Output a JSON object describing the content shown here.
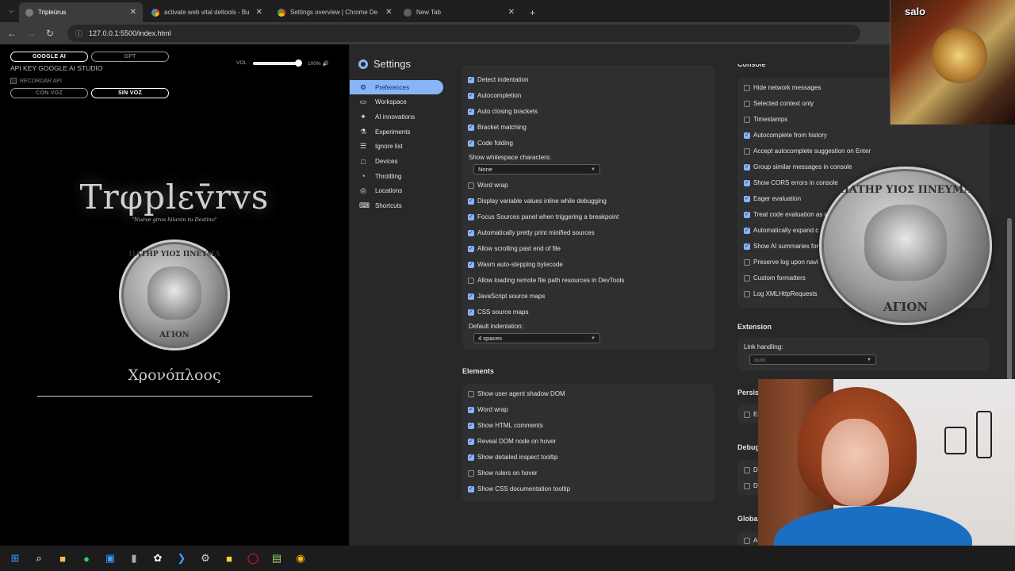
{
  "browser": {
    "tabs": [
      {
        "title": "Tripleūrus",
        "active": true
      },
      {
        "title": "activate web vital deltools - Bu"
      },
      {
        "title": "Settings overview | Chrome De"
      },
      {
        "title": "New Tab"
      }
    ],
    "url": "127.0.0.1:5500/index.html"
  },
  "app": {
    "btn_google": "GOOGLE AI",
    "btn_gpt": "GPT",
    "api_key_label": "API KEY GOOGLE AI STUDIO",
    "remember_label": "RECORDAR API",
    "btn_con_voz": "CON VOZ",
    "btn_sin_voz": "SIN VOZ",
    "vol_label": "VOL",
    "vol_pct": "100%",
    "volume": 0.95,
    "logo": "Trφplεv̄rvs",
    "tagline": "\"Nueve giros hilarán tu Destino\"",
    "coin_top": "ΠΑΤΗΡ ΥΙΟΣ ΠΝΕΥΜΑ",
    "coin_bottom": "ΑΓΙΟΝ",
    "subtitle": "Χρονόπλοος"
  },
  "settings": {
    "title": "Settings",
    "nav": [
      {
        "label": "Preferences",
        "icon": "gear-icon",
        "selected": true
      },
      {
        "label": "Workspace",
        "icon": "folder-icon"
      },
      {
        "label": "AI innovations",
        "icon": "sparkle-icon"
      },
      {
        "label": "Experiments",
        "icon": "flask-icon"
      },
      {
        "label": "Ignore list",
        "icon": "list-icon"
      },
      {
        "label": "Devices",
        "icon": "devices-icon"
      },
      {
        "label": "Throttling",
        "icon": "speedometer-icon"
      },
      {
        "label": "Locations",
        "icon": "pin-icon"
      },
      {
        "label": "Shortcuts",
        "icon": "keyboard-icon"
      }
    ],
    "sources": [
      {
        "label": "Detect indentation",
        "checked": true
      },
      {
        "label": "Autocompletion",
        "checked": true
      },
      {
        "label": "Auto closing brackets",
        "checked": true
      },
      {
        "label": "Bracket matching",
        "checked": true
      },
      {
        "label": "Code folding",
        "checked": true
      }
    ],
    "whitespace_label": "Show whitespace characters:",
    "whitespace_value": "None",
    "sources2": [
      {
        "label": "Word wrap",
        "checked": false
      },
      {
        "label": "Display variable values inline while debugging",
        "checked": true
      },
      {
        "label": "Focus Sources panel when triggering a breakpoint",
        "checked": true
      },
      {
        "label": "Automatically pretty print minified sources",
        "checked": true
      },
      {
        "label": "Allow scrolling past end of file",
        "checked": true
      },
      {
        "label": "Wasm auto-stepping bytecode",
        "checked": true
      },
      {
        "label": "Allow loading remote file path resources in DevTools",
        "checked": false
      },
      {
        "label": "JavaScript source maps",
        "checked": true
      },
      {
        "label": "CSS source maps",
        "checked": true
      }
    ],
    "indent_label": "Default indentation:",
    "indent_value": "4 spaces",
    "elements_title": "Elements",
    "elements": [
      {
        "label": "Show user agent shadow DOM",
        "checked": false
      },
      {
        "label": "Word wrap",
        "checked": true
      },
      {
        "label": "Show HTML comments",
        "checked": true
      },
      {
        "label": "Reveal DOM node on hover",
        "checked": true
      },
      {
        "label": "Show detailed inspect tooltip",
        "checked": true
      },
      {
        "label": "Show rulers on hover",
        "checked": false
      },
      {
        "label": "Show CSS documentation tooltip",
        "checked": true
      }
    ],
    "console_title": "Console",
    "console": [
      {
        "label": "Hide network messages",
        "checked": false
      },
      {
        "label": "Selected context only",
        "checked": false
      },
      {
        "label": "Timestamps",
        "checked": false
      },
      {
        "label": "Autocomplete from history",
        "checked": true
      },
      {
        "label": "Accept autocomplete suggestion on Enter",
        "checked": false
      },
      {
        "label": "Group similar messages in console",
        "checked": true
      },
      {
        "label": "Show CORS errors in console",
        "checked": true
      },
      {
        "label": "Eager evaluation",
        "checked": true
      },
      {
        "label": "Treat code evaluation as u",
        "checked": true
      },
      {
        "label": "Automatically expand c",
        "checked": true
      },
      {
        "label": "Show AI summaries for",
        "checked": true
      },
      {
        "label": "Preserve log upon navi",
        "checked": false
      },
      {
        "label": "Custom formatters",
        "checked": false
      },
      {
        "label": "Log XMLHttpRequests",
        "checked": false
      }
    ],
    "extension_title": "Extension",
    "link_handling_label": "Link handling:",
    "link_handling_value": "auto",
    "persist_title": "Persist",
    "persist_item": "En",
    "debug_title": "Debug",
    "debug_items": [
      "Di",
      "Di"
    ],
    "global_title": "Global",
    "global_item": "Au"
  },
  "overlay": {
    "cam_text": "salo"
  },
  "taskbar": [
    "windows-icon",
    "search-icon",
    "folder-icon",
    "whatsapp-icon",
    "store-icon",
    "notepad-icon",
    "chatgpt-icon",
    "vscode-icon",
    "app-icon",
    "sticky-notes-icon",
    "opera-icon",
    "notepad-plus-icon",
    "chrome-icon"
  ]
}
